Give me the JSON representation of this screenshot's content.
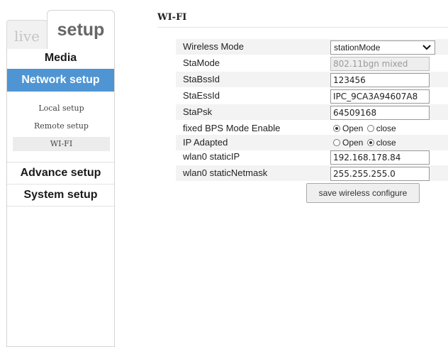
{
  "tabs": {
    "live": "live",
    "setup": "setup"
  },
  "sidebar": {
    "media": "Media",
    "network_setup": "Network setup",
    "sub_items": [
      "Local setup",
      "Remote setup",
      "WI-FI"
    ],
    "advance_setup": "Advance setup",
    "system_setup": "System setup"
  },
  "section": {
    "title": "WI-FI"
  },
  "form": {
    "wireless_mode": {
      "label": "Wireless Mode",
      "value": "stationMode"
    },
    "sta_mode": {
      "label": "StaMode",
      "value": "802.11bgn mixed"
    },
    "sta_bssid": {
      "label": "StaBssId",
      "value": "123456"
    },
    "sta_essid": {
      "label": "StaEssId",
      "value": "IPC_9CA3A94607A8"
    },
    "sta_psk": {
      "label": "StaPsk",
      "value": "64509168"
    },
    "fixed_bps": {
      "label": "fixed BPS Mode Enable",
      "open": "Open",
      "close": "close",
      "selected": "open"
    },
    "ip_adapted": {
      "label": "IP Adapted",
      "open": "Open",
      "close": "close",
      "selected": "close"
    },
    "static_ip": {
      "label": "wlan0 staticIP",
      "value": "192.168.178.84"
    },
    "static_netmask": {
      "label": "wlan0 staticNetmask",
      "value": "255.255.255.0"
    },
    "save_button": "save wireless configure"
  },
  "colors": {
    "accent": "#4f94d3",
    "row_shade": "#f3f3f3"
  }
}
